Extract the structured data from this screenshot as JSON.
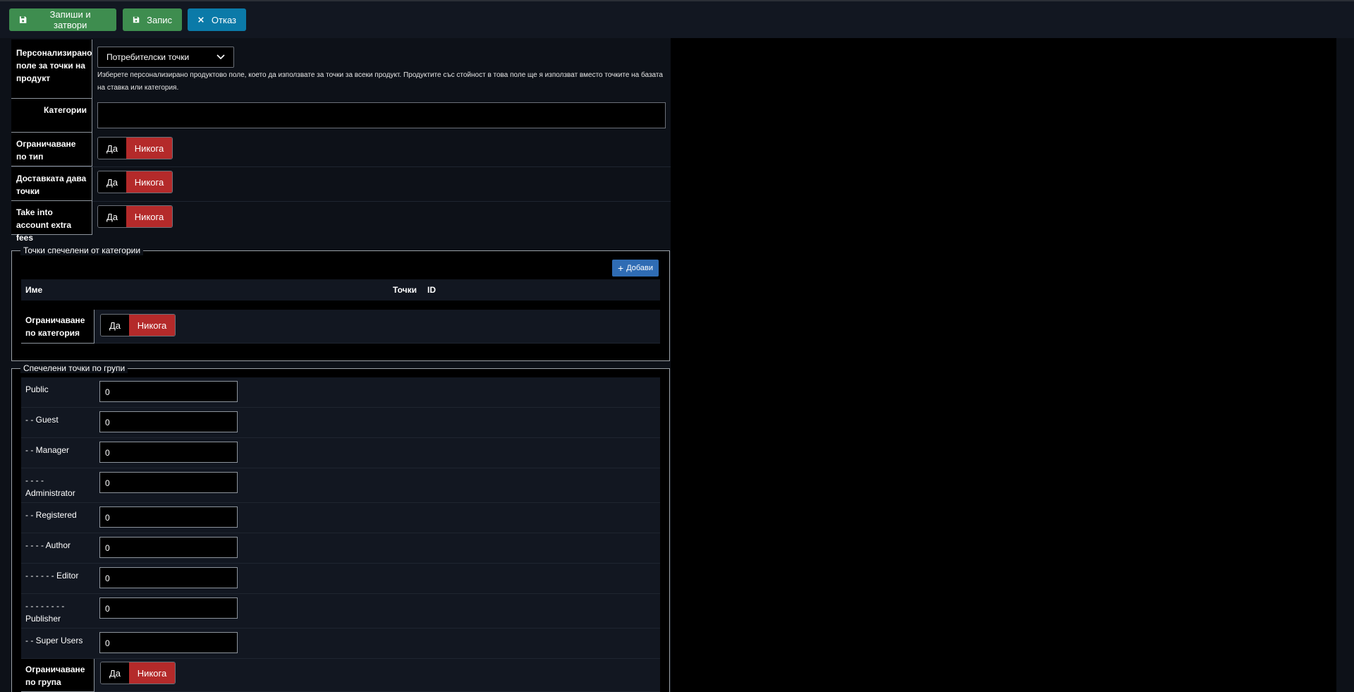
{
  "toolbar": {
    "save_close_label": "Запиши и затвори",
    "save_label": "Запис",
    "cancel_label": "Отказ",
    "green": "#3e8d4f",
    "blue": "#0b7aa8"
  },
  "form": {
    "custom_field": {
      "label": "Персонализирано поле за точки на продукт",
      "selected": "Потребителски точки",
      "description": "Изберете персонализирано продуктово поле, което да използвате за точки за всеки продукт. Продуктите със стойност в това поле ще я използват вместо точките на базата на ставка или категория."
    },
    "categories_label": "Категории",
    "restrict_type_label": "Ограничаване по тип",
    "shipping_points_label": "Доставката дава точки",
    "extra_fees_label": "Take into account extra fees",
    "yes": "Да",
    "never": "Никога"
  },
  "category_points": {
    "legend": "Точки спечелени от категории",
    "add_label": "Добави",
    "columns": {
      "name": "Име",
      "points": "Точки",
      "id": "ID"
    },
    "restrict_label": "Ограничаване по категория"
  },
  "group_points": {
    "legend": "Спечелени точки по групи",
    "rows": [
      {
        "label": "Public",
        "value": "0"
      },
      {
        "label": "- - Guest",
        "value": "0"
      },
      {
        "label": "- - Manager",
        "value": "0"
      },
      {
        "label": "- - - - Administrator",
        "value": "0"
      },
      {
        "label": "- - Registered",
        "value": "0"
      },
      {
        "label": "- - - - Author",
        "value": "0"
      },
      {
        "label": "- - - - - - Editor",
        "value": "0"
      },
      {
        "label": "- - - - - - - - Publisher",
        "value": "0"
      },
      {
        "label": "- - Super Users",
        "value": "0"
      }
    ],
    "restrict_label": "Ограничаване по група"
  }
}
